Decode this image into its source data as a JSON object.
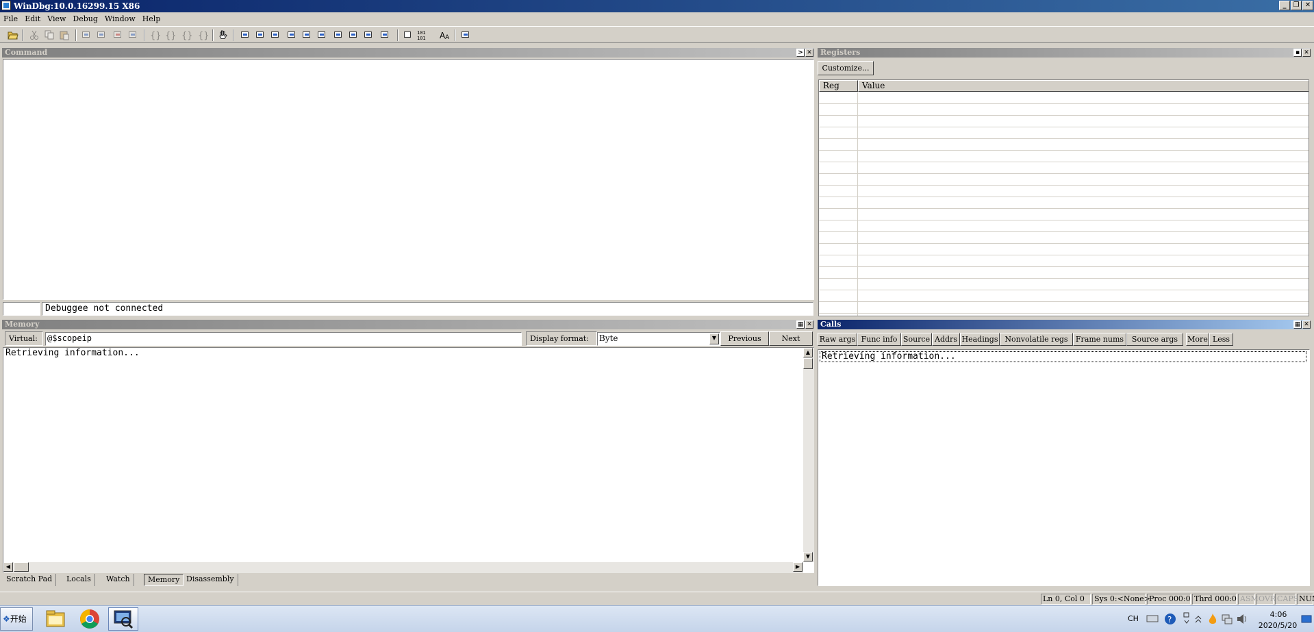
{
  "window": {
    "title": "WinDbg:10.0.16299.15 X86"
  },
  "menu": [
    "File",
    "Edit",
    "View",
    "Debug",
    "Window",
    "Help"
  ],
  "command_pane": {
    "title": "Command",
    "status": "Debuggee not connected"
  },
  "registers_pane": {
    "title": "Registers",
    "customize_label": "Customize...",
    "col_reg": "Reg",
    "col_value": "Value"
  },
  "memory_pane": {
    "title": "Memory",
    "virtual_label": "Virtual:",
    "virtual_value": "@$scopeip",
    "display_format_label": "Display format:",
    "display_format_value": "Byte",
    "previous_label": "Previous",
    "next_label": "Next",
    "content": "Retrieving information..."
  },
  "calls_pane": {
    "title": "Calls",
    "buttons": [
      "Raw args",
      "Func info",
      "Source",
      "Addrs",
      "Headings",
      "Nonvolatile regs",
      "Frame nums",
      "Source args",
      "More",
      "Less"
    ],
    "content": "Retrieving information..."
  },
  "bottom_tabs": [
    "Scratch Pad",
    "Locals",
    "Watch",
    "Memory",
    "Disassembly"
  ],
  "active_tab": "Memory",
  "status": [
    "Ln 0, Col 0",
    "Sys 0:<None>",
    "Proc 000:0",
    "Thrd 000:0",
    "ASM",
    "OVR",
    "CAPS",
    "NUM"
  ],
  "taskbar": {
    "start_label": "开始",
    "ime": "CH",
    "time": "4:06",
    "date": "2020/5/20"
  }
}
